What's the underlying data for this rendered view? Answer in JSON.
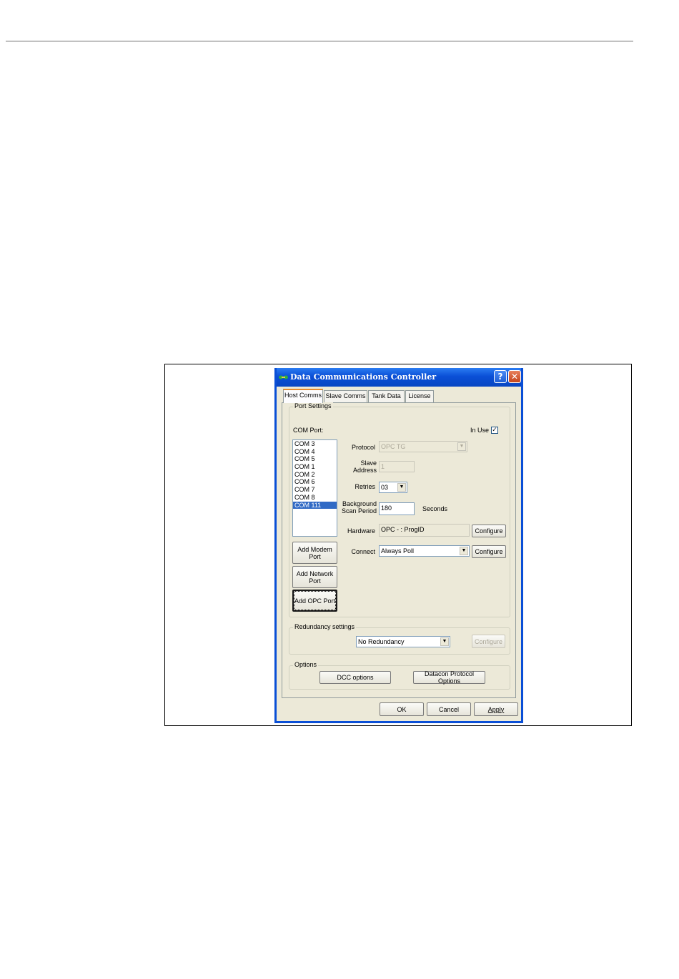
{
  "window": {
    "title": "Data Communications Controller",
    "help_glyph": "?",
    "close_glyph": "✕"
  },
  "tabs": [
    {
      "label": "Host Comms",
      "active": true
    },
    {
      "label": "Slave Comms",
      "active": false
    },
    {
      "label": "Tank Data",
      "active": false
    },
    {
      "label": "License",
      "active": false
    }
  ],
  "port_settings": {
    "legend": "Port Settings",
    "com_port_label": "COM Port:",
    "in_use_label": "In Use",
    "in_use_checked": true,
    "com_ports": [
      "COM 3",
      "COM 4",
      "COM 5",
      "COM 1",
      "COM 2",
      "COM 6",
      "COM 7",
      "COM 8",
      "COM 111"
    ],
    "selected_port": "COM 111",
    "protocol_label": "Protocol",
    "protocol_value": "OPC TG",
    "slave_address_label_1": "Slave",
    "slave_address_label_2": "Address",
    "slave_address_value": "1",
    "retries_label": "Retries",
    "retries_value": "03",
    "background_label_1": "Background",
    "background_label_2": "Scan Period",
    "background_value": "180",
    "seconds_label": "Seconds",
    "hardware_label": "Hardware",
    "hardware_value": "OPC - : ProgID",
    "hardware_configure": "Configure",
    "connect_label": "Connect",
    "connect_value": "Always Poll",
    "connect_configure": "Configure",
    "add_modem_1": "Add Modem",
    "add_modem_2": "Port",
    "add_network_1": "Add Network",
    "add_network_2": "Port",
    "add_opc": "Add OPC Port"
  },
  "redundancy": {
    "legend": "Redundancy settings",
    "value": "No Redundancy",
    "configure": "Configure"
  },
  "options": {
    "legend": "Options",
    "dcc_options": "DCC options",
    "datacon_options": "Datacon Protocol Options"
  },
  "footer": {
    "ok": "OK",
    "cancel": "Cancel",
    "apply": "Apply"
  },
  "colors": {
    "title_bar": "#0a4fd6",
    "selection": "#316ac5",
    "dialog_face": "#ece9d8",
    "close_button": "#c4451d"
  }
}
